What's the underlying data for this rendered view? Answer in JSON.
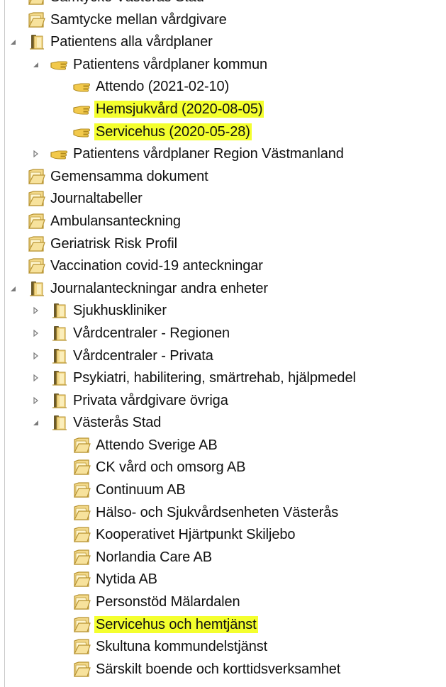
{
  "tree": {
    "items": [
      {
        "label": "Samtycke Västerås Stad",
        "level": 0,
        "icon": "note-folder-icon",
        "expander": "none"
      },
      {
        "label": "Samtycke mellan vårdgivare",
        "level": 0,
        "icon": "note-folder-icon",
        "expander": "none"
      },
      {
        "label": "Patientens alla vårdplaner",
        "level": 0,
        "icon": "book-folder-icon",
        "expander": "expanded"
      },
      {
        "label": "Patientens vårdplaner kommun",
        "level": 1,
        "icon": "hand-icon",
        "expander": "expanded"
      },
      {
        "label": "Attendo (2021-02-10)",
        "level": 2,
        "icon": "hand-icon",
        "expander": "none"
      },
      {
        "label": "Hemsjukvård (2020-08-05)",
        "level": 2,
        "icon": "hand-icon",
        "expander": "none",
        "highlighted": true
      },
      {
        "label": "Servicehus (2020-05-28)",
        "level": 2,
        "icon": "hand-icon",
        "expander": "none",
        "highlighted": true
      },
      {
        "label": "Patientens vårdplaner Region Västmanland",
        "level": 1,
        "icon": "hand-icon",
        "expander": "collapsed"
      },
      {
        "label": "Gemensamma dokument",
        "level": 0,
        "icon": "note-folder-icon",
        "expander": "none"
      },
      {
        "label": "Journaltabeller",
        "level": 0,
        "icon": "note-folder-icon",
        "expander": "none"
      },
      {
        "label": "Ambulansanteckning",
        "level": 0,
        "icon": "note-folder-icon",
        "expander": "none"
      },
      {
        "label": "Geriatrisk Risk Profil",
        "level": 0,
        "icon": "note-folder-icon",
        "expander": "none"
      },
      {
        "label": "Vaccination covid-19 anteckningar",
        "level": 0,
        "icon": "note-folder-icon",
        "expander": "none"
      },
      {
        "label": "Journalanteckningar andra enheter",
        "level": 0,
        "icon": "book-folder-icon",
        "expander": "expanded"
      },
      {
        "label": "Sjukhuskliniker",
        "level": 1,
        "icon": "book-folder-icon",
        "expander": "collapsed"
      },
      {
        "label": "Vårdcentraler - Regionen",
        "level": 1,
        "icon": "book-folder-icon",
        "expander": "collapsed"
      },
      {
        "label": "Vårdcentraler - Privata",
        "level": 1,
        "icon": "book-folder-icon",
        "expander": "collapsed"
      },
      {
        "label": "Psykiatri, habilitering, smärtrehab, hjälpmedel",
        "level": 1,
        "icon": "book-folder-icon",
        "expander": "collapsed"
      },
      {
        "label": "Privata vårdgivare övriga",
        "level": 1,
        "icon": "book-folder-icon",
        "expander": "collapsed"
      },
      {
        "label": "Västerås Stad",
        "level": 1,
        "icon": "book-folder-icon",
        "expander": "expanded"
      },
      {
        "label": "Attendo Sverige AB",
        "level": 2,
        "icon": "note-folder-icon",
        "expander": "none"
      },
      {
        "label": "CK vård och omsorg AB",
        "level": 2,
        "icon": "note-folder-icon",
        "expander": "none"
      },
      {
        "label": "Continuum AB",
        "level": 2,
        "icon": "note-folder-icon",
        "expander": "none"
      },
      {
        "label": "Hälso- och Sjukvårdsenheten Västerås",
        "level": 2,
        "icon": "note-folder-icon",
        "expander": "none"
      },
      {
        "label": "Kooperativet Hjärtpunkt Skiljebo",
        "level": 2,
        "icon": "note-folder-icon",
        "expander": "none"
      },
      {
        "label": "Norlandia Care AB",
        "level": 2,
        "icon": "note-folder-icon",
        "expander": "none"
      },
      {
        "label": "Nytida AB",
        "level": 2,
        "icon": "note-folder-icon",
        "expander": "none"
      },
      {
        "label": "Personstöd Mälardalen",
        "level": 2,
        "icon": "note-folder-icon",
        "expander": "none"
      },
      {
        "label": "Servicehus och hemtjänst",
        "level": 2,
        "icon": "note-folder-icon",
        "expander": "none",
        "highlighted": true
      },
      {
        "label": "Skultuna kommundelstjänst",
        "level": 2,
        "icon": "note-folder-icon",
        "expander": "none"
      },
      {
        "label": "Särskilt boende och korttidsverksamhet",
        "level": 2,
        "icon": "note-folder-icon",
        "expander": "none"
      }
    ]
  },
  "colors": {
    "highlight": "#f4ff2e",
    "text": "#111111",
    "expander": "#7a7a7a",
    "folder": "#f3d98a",
    "folder_outline": "#b89432",
    "book_spine": "#6b5a2a",
    "hand": "#f2c94c"
  }
}
